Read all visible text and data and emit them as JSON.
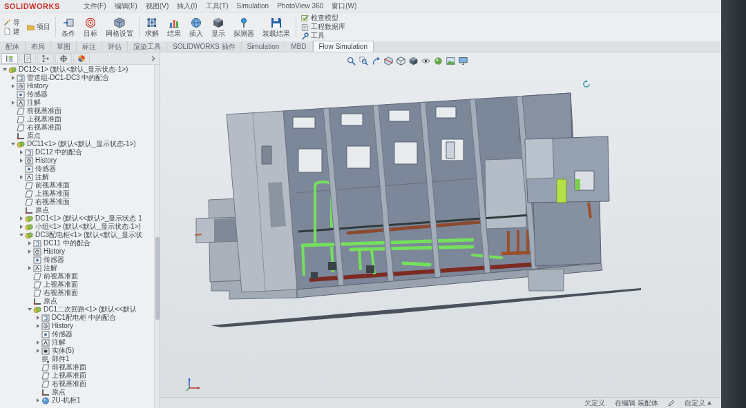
{
  "window": {
    "logo": "SOLIDWORKS"
  },
  "menu": [
    "文件(F)",
    "编辑(E)",
    "视图(V)",
    "插入(I)",
    "工具(T)",
    "Simulation",
    "PhotoView 360",
    "窗口(W)"
  ],
  "ribbon": [
    {
      "kind": "stack",
      "buttons": [
        "导",
        "建"
      ]
    },
    {
      "kind": "stack",
      "buttons": [
        "项目"
      ]
    },
    {
      "kind": "large",
      "label": "条件"
    },
    {
      "kind": "large",
      "label": "目标"
    },
    {
      "kind": "large",
      "label": "网格设置"
    },
    {
      "kind": "large",
      "label": "求解"
    },
    {
      "kind": "large",
      "label": "结果"
    },
    {
      "kind": "large",
      "label": "插入"
    },
    {
      "kind": "large",
      "label": "显示"
    },
    {
      "kind": "large",
      "label": "探测器"
    },
    {
      "kind": "large",
      "label": "装载结果"
    },
    {
      "kind": "stack",
      "buttons": [
        "检查模型",
        "工程数据库",
        "工具"
      ]
    }
  ],
  "tabs": [
    {
      "label": "配体",
      "selected": false
    },
    {
      "label": "布局",
      "selected": false
    },
    {
      "label": "草图",
      "selected": false
    },
    {
      "label": "标注",
      "selected": false
    },
    {
      "label": "评估",
      "selected": false
    },
    {
      "label": "渲染工具",
      "selected": false
    },
    {
      "label": "SOLIDWORKS 插件",
      "selected": false
    },
    {
      "label": "Simulation",
      "selected": false
    },
    {
      "label": "MBD",
      "selected": false
    },
    {
      "label": "Flow Simulation",
      "selected": true
    }
  ],
  "feature_tree": {
    "tabs": [
      {
        "selected": true
      },
      {
        "selected": false
      },
      {
        "selected": false
      },
      {
        "selected": false
      },
      {
        "selected": false
      }
    ],
    "nodes": [
      {
        "label": "DC12<1> (默认<默认_显示状态-1>)",
        "kind": "assembly",
        "expanded": true,
        "children": [
          {
            "label": "管道组-DC1-DC3 中的配合",
            "kind": "mates",
            "expanded": false
          },
          {
            "label": "History",
            "kind": "history",
            "expanded": false
          },
          {
            "label": "传感器",
            "kind": "sensors"
          },
          {
            "label": "注解",
            "kind": "annotations",
            "expanded": false
          },
          {
            "label": "前视基准面",
            "kind": "plane"
          },
          {
            "label": "上视基准面",
            "kind": "plane"
          },
          {
            "label": "右视基准面",
            "kind": "plane"
          },
          {
            "label": "原点",
            "kind": "origin"
          },
          {
            "label": "DC11<1> (默认<默认_显示状态-1>)",
            "kind": "assembly",
            "expanded": true,
            "children": [
              {
                "label": "DC12 中的配合",
                "kind": "mates",
                "expanded": false
              },
              {
                "label": "History",
                "kind": "history",
                "expanded": false
              },
              {
                "label": "传感器",
                "kind": "sensors"
              },
              {
                "label": "注解",
                "kind": "annotations",
                "expanded": false
              },
              {
                "label": "前视基准面",
                "kind": "plane"
              },
              {
                "label": "上视基准面",
                "kind": "plane"
              },
              {
                "label": "右视基准面",
                "kind": "plane"
              },
              {
                "label": "原点",
                "kind": "origin"
              },
              {
                "label": "DC1<1> (默认<<默认>_显示状态 1",
                "kind": "assembly",
                "expanded": false
              },
              {
                "label": "小组<1> (默认<默认_显示状态-1>)",
                "kind": "assembly",
                "expanded": false
              },
              {
                "label": "DC3配电柜<1> (默认<默认_显示状",
                "kind": "assembly",
                "expanded": true,
                "children": [
                  {
                    "label": "DC11 中的配合",
                    "kind": "mates",
                    "expanded": false
                  },
                  {
                    "label": "History",
                    "kind": "history",
                    "expanded": false
                  },
                  {
                    "label": "传感器",
                    "kind": "sensors"
                  },
                  {
                    "label": "注解",
                    "kind": "annotations",
                    "expanded": false
                  },
                  {
                    "label": "前视基准面",
                    "kind": "plane"
                  },
                  {
                    "label": "上视基准面",
                    "kind": "plane"
                  },
                  {
                    "label": "右视基准面",
                    "kind": "plane"
                  },
                  {
                    "label": "原点",
                    "kind": "origin"
                  },
                  {
                    "label": "DC1二次回路<1> (默认<<默认",
                    "kind": "assembly",
                    "expanded": true,
                    "children": [
                      {
                        "label": "DC1配电柜 中的配合",
                        "kind": "mates",
                        "expanded": false
                      },
                      {
                        "label": "History",
                        "kind": "history",
                        "expanded": false
                      },
                      {
                        "label": "传感器",
                        "kind": "sensors"
                      },
                      {
                        "label": "注解",
                        "kind": "annotations",
                        "expanded": false
                      },
                      {
                        "label": "实体(5)",
                        "kind": "bodies",
                        "expanded": false
                      },
                      {
                        "label": "部件1",
                        "kind": "material"
                      },
                      {
                        "label": "前视基准面",
                        "kind": "plane"
                      },
                      {
                        "label": "上视基准面",
                        "kind": "plane"
                      },
                      {
                        "label": "右视基准面",
                        "kind": "plane"
                      },
                      {
                        "label": "原点",
                        "kind": "origin"
                      },
                      {
                        "label": "2U-机柜1",
                        "kind": "part",
                        "expanded": false
                      }
                    ]
                  }
                ]
              }
            ]
          }
        ]
      }
    ]
  },
  "status_bar": {
    "items": [
      "欠定义",
      "在编辑 装配体"
    ],
    "units": "自定义"
  }
}
